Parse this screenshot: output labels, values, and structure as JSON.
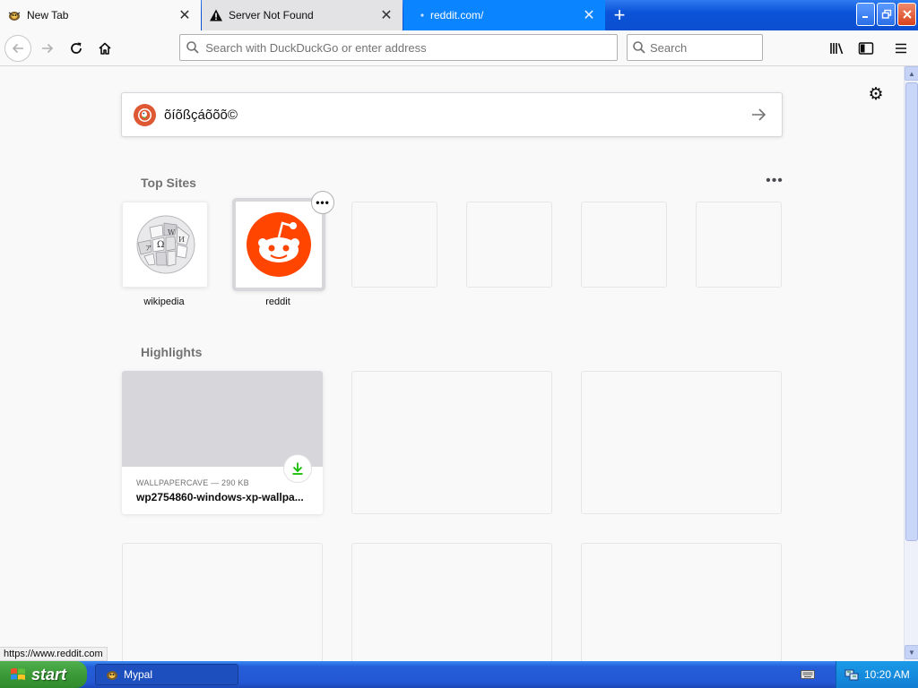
{
  "tabs": [
    {
      "label": "New Tab",
      "icon": "mypal-icon",
      "active": false
    },
    {
      "label": "Server Not Found",
      "icon": "warning-icon",
      "active": false
    },
    {
      "label": "reddit.com/",
      "icon": "loading-dot-icon",
      "active": true
    }
  ],
  "toolbar": {
    "url_placeholder": "Search with DuckDuckGo or enter address",
    "search_placeholder": "Search"
  },
  "page": {
    "search_text": "õíõßçáõõõ©",
    "top_sites_title": "Top Sites",
    "top_sites": [
      {
        "label": "wikipedia",
        "icon": "wikipedia-globe-icon"
      },
      {
        "label": "reddit",
        "icon": "reddit-alien-icon",
        "brand_color": "#ff4500"
      }
    ],
    "highlights_title": "Highlights",
    "highlights": [
      {
        "context": "WALLPAPERCAVE — 290 KB",
        "title": "wp2754860-windows-xp-wallpa..."
      }
    ]
  },
  "status_url": "https://www.reddit.com",
  "taskbar": {
    "start_label": "start",
    "app_label": "Mypal",
    "clock": "10:20 AM"
  },
  "colors": {
    "accent": "#0a84ff",
    "duckduckgo": "#de5833",
    "download_green": "#12bc00",
    "reddit": "#ff4500"
  }
}
